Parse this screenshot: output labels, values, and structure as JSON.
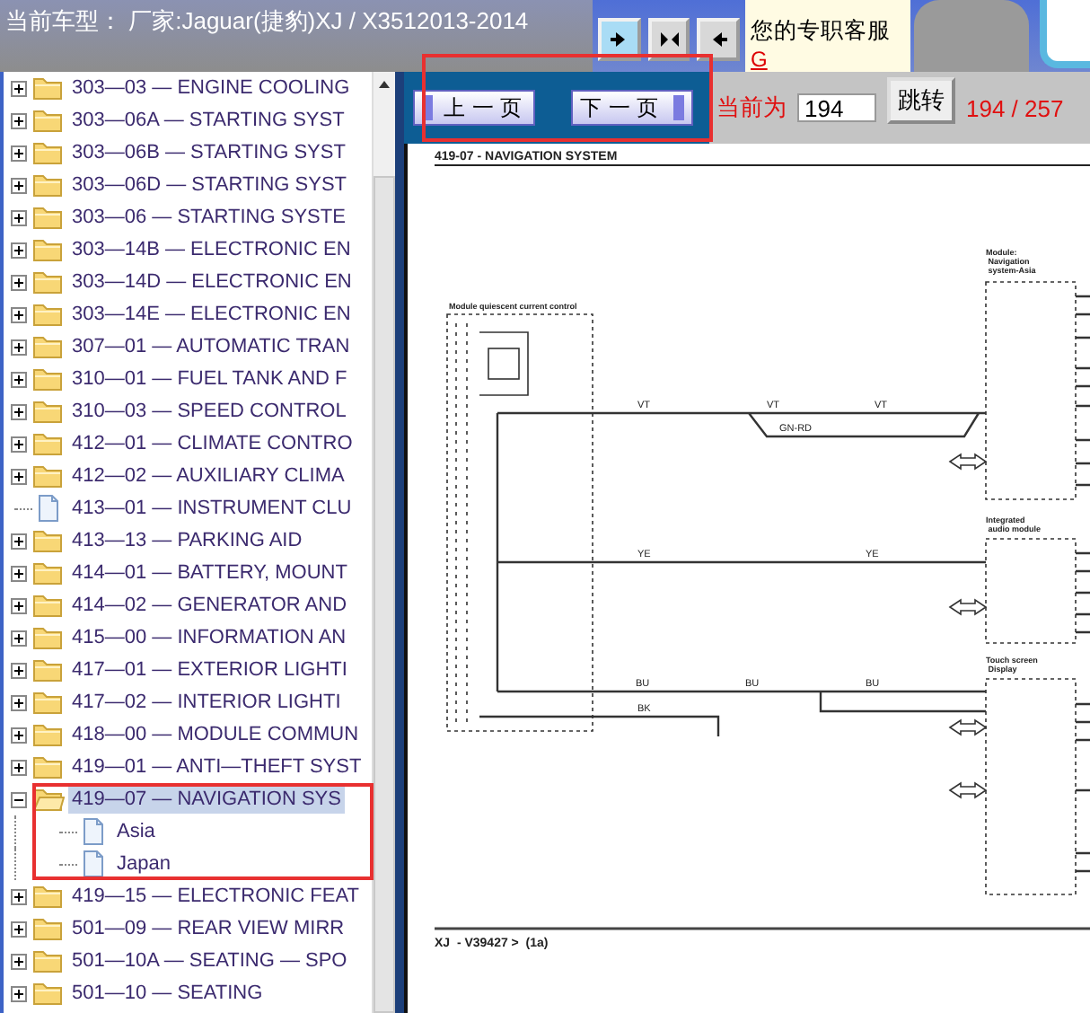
{
  "header": {
    "car_model": "当前车型： 厂家:Jaguar(捷豹)XJ / X3512013-2014",
    "service_label": "您的专职客服",
    "service_link": "G"
  },
  "tree": [
    {
      "label": "303—03 — ENGINE COOLING",
      "kind": "folder",
      "expanded": false,
      "selected": false
    },
    {
      "label": "303—06A — STARTING SYST",
      "kind": "folder",
      "expanded": false,
      "selected": false
    },
    {
      "label": "303—06B — STARTING SYST",
      "kind": "folder",
      "expanded": false,
      "selected": false
    },
    {
      "label": "303—06D — STARTING SYST",
      "kind": "folder",
      "expanded": false,
      "selected": false
    },
    {
      "label": "303—06 — STARTING SYSTE",
      "kind": "folder",
      "expanded": false,
      "selected": false
    },
    {
      "label": "303—14B — ELECTRONIC EN",
      "kind": "folder",
      "expanded": false,
      "selected": false
    },
    {
      "label": "303—14D — ELECTRONIC EN",
      "kind": "folder",
      "expanded": false,
      "selected": false
    },
    {
      "label": "303—14E — ELECTRONIC EN",
      "kind": "folder",
      "expanded": false,
      "selected": false
    },
    {
      "label": "307—01 — AUTOMATIC TRAN",
      "kind": "folder",
      "expanded": false,
      "selected": false
    },
    {
      "label": "310—01 — FUEL TANK AND F",
      "kind": "folder",
      "expanded": false,
      "selected": false
    },
    {
      "label": "310—03 — SPEED CONTROL",
      "kind": "folder",
      "expanded": false,
      "selected": false
    },
    {
      "label": "412—01 — CLIMATE CONTRO",
      "kind": "folder",
      "expanded": false,
      "selected": false
    },
    {
      "label": "412—02 — AUXILIARY CLIMA",
      "kind": "folder",
      "expanded": false,
      "selected": false
    },
    {
      "label": "413—01 — INSTRUMENT CLU",
      "kind": "page",
      "selected": false
    },
    {
      "label": "413—13 — PARKING AID",
      "kind": "folder",
      "expanded": false,
      "selected": false
    },
    {
      "label": "414—01 — BATTERY, MOUNT",
      "kind": "folder",
      "expanded": false,
      "selected": false
    },
    {
      "label": "414—02 — GENERATOR AND",
      "kind": "folder",
      "expanded": false,
      "selected": false
    },
    {
      "label": "415—00 — INFORMATION AN",
      "kind": "folder",
      "expanded": false,
      "selected": false
    },
    {
      "label": "417—01 — EXTERIOR LIGHTI",
      "kind": "folder",
      "expanded": false,
      "selected": false
    },
    {
      "label": "417—02 — INTERIOR LIGHTI",
      "kind": "folder",
      "expanded": false,
      "selected": false
    },
    {
      "label": "418—00 — MODULE COMMUN",
      "kind": "folder",
      "expanded": false,
      "selected": false
    },
    {
      "label": "419—01 — ANTI—THEFT SYST",
      "kind": "folder",
      "expanded": false,
      "selected": false
    },
    {
      "label": "419—07 — NAVIGATION SYS",
      "kind": "folder",
      "expanded": true,
      "selected": true,
      "children": [
        {
          "label": "Asia",
          "kind": "page",
          "selected": false
        },
        {
          "label": "Japan",
          "kind": "page",
          "selected": false
        }
      ]
    },
    {
      "label": "419—15 — ELECTRONIC FEAT",
      "kind": "folder",
      "expanded": false,
      "selected": false
    },
    {
      "label": "501—09 — REAR VIEW MIRR",
      "kind": "folder",
      "expanded": false,
      "selected": false
    },
    {
      "label": "501—10A — SEATING — SPO",
      "kind": "folder",
      "expanded": false,
      "selected": false
    },
    {
      "label": "501—10 — SEATING",
      "kind": "folder",
      "expanded": false,
      "selected": false
    }
  ],
  "pager": {
    "prev_button": "上 一 页",
    "next_button": "下 一 页",
    "current_label": "当前为",
    "page_input": "194",
    "jump_button": "跳转",
    "page_count": "194 / 257"
  },
  "document": {
    "title": "419-07 - NAVIGATION SYSTEM",
    "modules": [
      "Module quiescent current control",
      "Module: Navigation system-Asia",
      "Integrated audio module",
      "Touch screen Display"
    ],
    "wire_labels": [
      "VT",
      "VT",
      "VT",
      "GN-RD",
      "YE",
      "YE",
      "BU",
      "BU",
      "BU",
      "BK"
    ],
    "footer": "XJ  - V39427 >  (1a)"
  }
}
